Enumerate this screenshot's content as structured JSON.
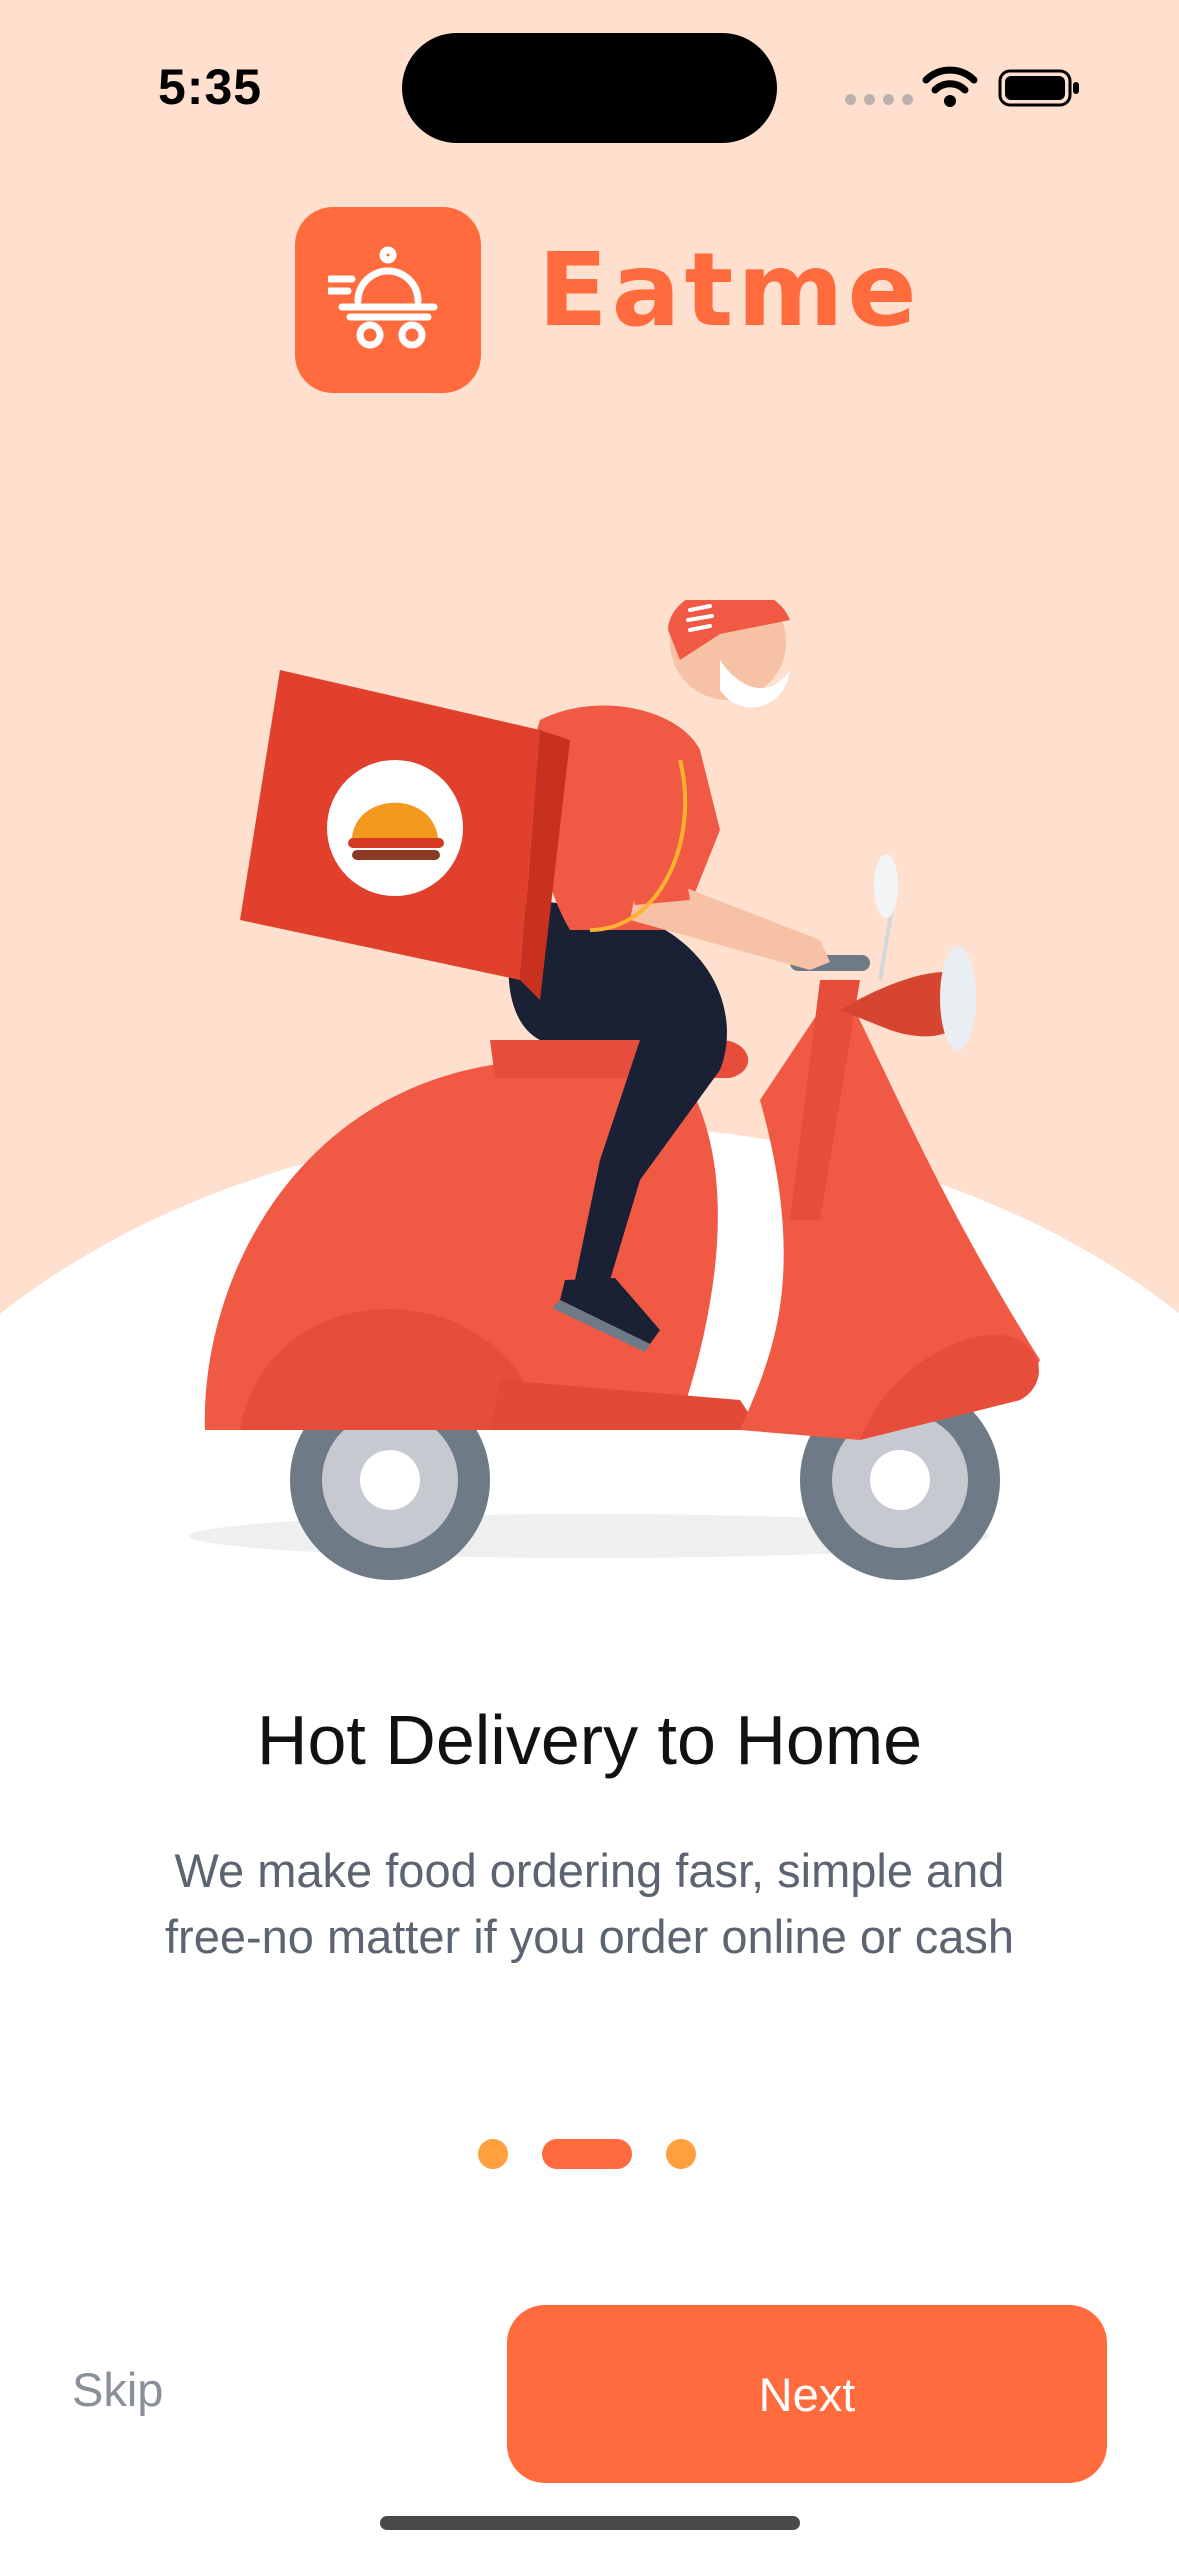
{
  "status_bar": {
    "time": "5:35"
  },
  "header": {
    "brand_name": "Eatme",
    "logo_icon": "cloche-delivery-icon"
  },
  "hero": {
    "illustration": "delivery-scooter-illustration"
  },
  "onboarding": {
    "title": "Hot Delivery to Home",
    "subtitle_line1": "We make food ordering fasr, simple and",
    "subtitle_line2": "free-no matter if you order online or cash",
    "page_count": 3,
    "active_page": 2
  },
  "actions": {
    "skip_label": "Skip",
    "next_label": "Next"
  },
  "colors": {
    "accent": "#FF6B3D",
    "dot": "#FF9F3D",
    "background_peach": "#FFE0CF",
    "scooter_red": "#F05A45"
  }
}
